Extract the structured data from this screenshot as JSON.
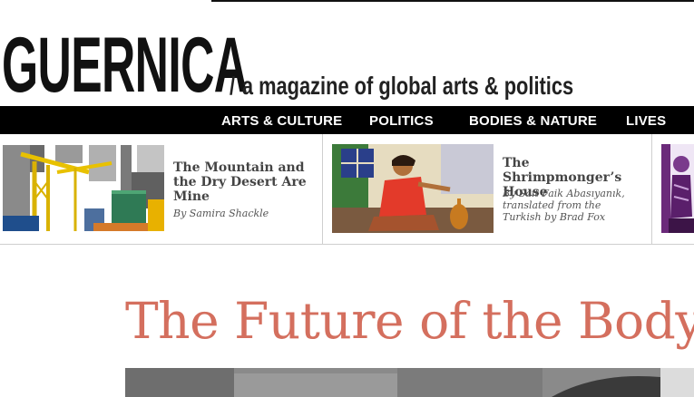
{
  "brand": {
    "logo_text": "GUERNICA",
    "tagline_slash": "/",
    "tagline": "a magazine of global arts & politics"
  },
  "nav": {
    "items": [
      {
        "label": "ARTS & CULTURE"
      },
      {
        "label": "POLITICS"
      },
      {
        "label": "BODIES & NATURE"
      },
      {
        "label": "LIVES"
      }
    ]
  },
  "features": [
    {
      "title": "The Mountain and the Dry Desert Are Mine",
      "byline": "By Samira Shackle",
      "image": "cranes-illustration"
    },
    {
      "title": "The Shrimpmonger’s House",
      "byline": "By Sait Faik Abasıyanık, translated from the Turkish by Brad Fox",
      "image": "woman-painting"
    },
    {
      "title": "",
      "byline": "",
      "image": "purple-figure-illustration"
    }
  ],
  "article": {
    "headline": "The Future of the Body",
    "hero_image": "black-and-white-photo"
  },
  "colors": {
    "headline": "#d46f5e",
    "nav_bg": "#000000",
    "nav_text": "#ffffff",
    "feature_title": "#444444"
  }
}
